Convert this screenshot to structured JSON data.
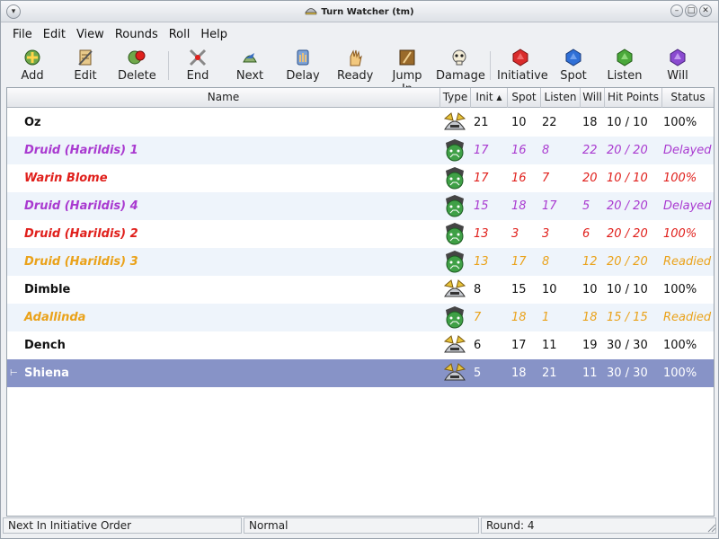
{
  "window": {
    "title": "Turn Watcher (tm)"
  },
  "menu": [
    "File",
    "Edit",
    "View",
    "Rounds",
    "Roll",
    "Help"
  ],
  "toolbar": {
    "add": "Add",
    "edit": "Edit",
    "delete": "Delete",
    "end": "End",
    "next": "Next",
    "delay": "Delay",
    "ready": "Ready",
    "jump_in": "Jump In",
    "damage": "Damage",
    "initiative": "Initiative",
    "spot": "Spot",
    "listen": "Listen",
    "will": "Will"
  },
  "table": {
    "headers": {
      "name": "Name",
      "type": "Type",
      "init": "Init",
      "spot": "Spot",
      "listen": "Listen",
      "will": "Will",
      "hp": "Hit Points",
      "status": "Status"
    },
    "sort_indicator": "▲",
    "rows": [
      {
        "name": "Oz",
        "type": "pc",
        "init": "21",
        "spot": "10",
        "listen": "22",
        "will": "18",
        "hp": "10 / 10",
        "status": "100%"
      },
      {
        "name": "Druid (Harildis) 1",
        "type": "monster",
        "init": "17",
        "spot": "16",
        "listen": "8",
        "will": "22",
        "hp": "20 / 20",
        "status": "Delayed"
      },
      {
        "name": "Warin Blome",
        "type": "monster",
        "init": "17",
        "spot": "16",
        "listen": "7",
        "will": "20",
        "hp": "10 / 10",
        "status": "100%"
      },
      {
        "name": "Druid (Harildis) 4",
        "type": "monster",
        "init": "15",
        "spot": "18",
        "listen": "17",
        "will": "5",
        "hp": "20 / 20",
        "status": "Delayed"
      },
      {
        "name": "Druid (Harildis) 2",
        "type": "monster",
        "init": "13",
        "spot": "3",
        "listen": "3",
        "will": "6",
        "hp": "20 / 20",
        "status": "100%"
      },
      {
        "name": "Druid (Harildis) 3",
        "type": "monster",
        "init": "13",
        "spot": "17",
        "listen": "8",
        "will": "12",
        "hp": "20 / 20",
        "status": "Readied"
      },
      {
        "name": "Dimble",
        "type": "pc",
        "init": "8",
        "spot": "15",
        "listen": "10",
        "will": "10",
        "hp": "10 / 10",
        "status": "100%"
      },
      {
        "name": "Adallinda",
        "type": "monster",
        "init": "7",
        "spot": "18",
        "listen": "1",
        "will": "18",
        "hp": "15 / 15",
        "status": "Readied"
      },
      {
        "name": "Dench",
        "type": "pc",
        "init": "6",
        "spot": "17",
        "listen": "11",
        "will": "19",
        "hp": "30 / 30",
        "status": "100%"
      },
      {
        "name": "Shiena",
        "type": "pc",
        "init": "5",
        "spot": "18",
        "listen": "21",
        "will": "11",
        "hp": "30 / 30",
        "status": "100%"
      }
    ]
  },
  "status_bar": {
    "left": "Next In Initiative Order",
    "middle": "Normal",
    "right": "Round: 4"
  },
  "colors": {
    "purple": "#a93ad0",
    "red": "#e0201c",
    "orange": "#eaa21a",
    "selected": "#8793c7"
  }
}
